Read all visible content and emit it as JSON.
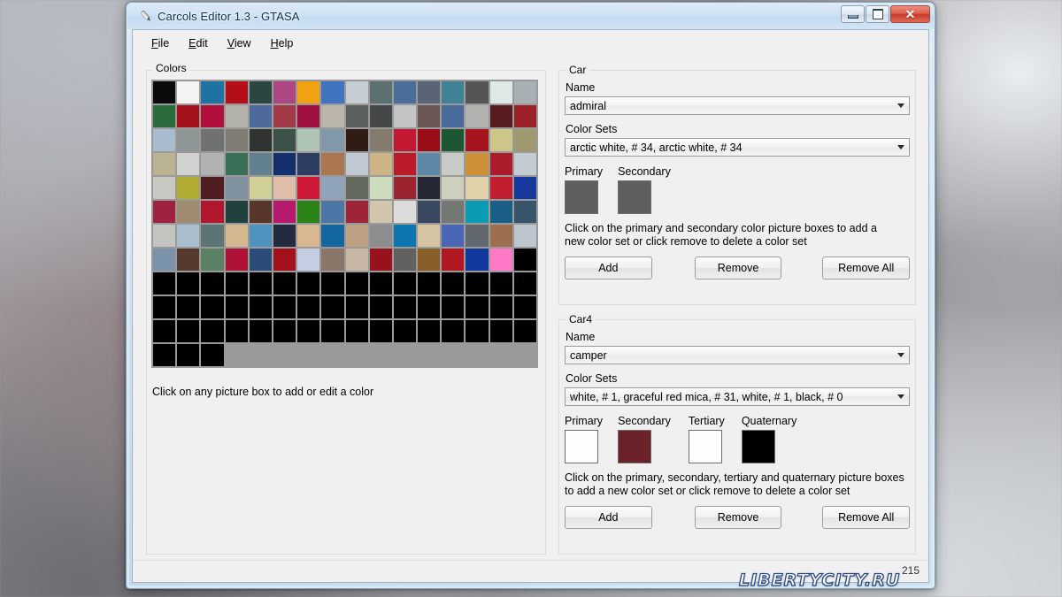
{
  "window": {
    "title": "Carcols Editor 1.3 - GTASA",
    "icon": "pen-icon",
    "buttons": {
      "minimize": "minimize-icon",
      "maximize": "maximize-icon",
      "close": "✕"
    }
  },
  "menu": {
    "items": [
      {
        "label": "File",
        "accel": "F"
      },
      {
        "label": "Edit",
        "accel": "E"
      },
      {
        "label": "View",
        "accel": "V"
      },
      {
        "label": "Help",
        "accel": "H"
      }
    ]
  },
  "colors_panel": {
    "label": "Colors",
    "hint": "Click on any picture box to add or edit a color",
    "columns": 16,
    "swatches": [
      "#0a0a0a",
      "#f3f3f1",
      "#1f72a4",
      "#b50e18",
      "#2b4540",
      "#ab4783",
      "#f0a210",
      "#4073bf",
      "#c7ced3",
      "#5c7070",
      "#4a6d9a",
      "#5a6476",
      "#3f8296",
      "#555555",
      "#dfe7e7",
      "#a9b0b4",
      "#2a6a3c",
      "#a4101c",
      "#b0103b",
      "#b2b2ab",
      "#4d6a9a",
      "#a23a48",
      "#a01141",
      "#bbb6ab",
      "#5c5f5f",
      "#454848",
      "#c4c4c4",
      "#6a5653",
      "#4b6a9c",
      "#b2b2b0",
      "#561c1f",
      "#9c2027",
      "#a7bccf",
      "#8d9695",
      "#707270",
      "#807d74",
      "#2f3432",
      "#3a5247",
      "#b0c4b5",
      "#8198a8",
      "#2e1c15",
      "#857b6d",
      "#c31832",
      "#9a0c18",
      "#1c5632",
      "#a6151e",
      "#cdc689",
      "#a09970",
      "#bab291",
      "#cfd2cf",
      "#b2b2b2",
      "#3a7055",
      "#63808e",
      "#13306e",
      "#2c3d61",
      "#ab7752",
      "#c0c8d2",
      "#cdb487",
      "#bb1a2a",
      "#5e86a8",
      "#c8cbc5",
      "#cd9037",
      "#ad1c2d",
      "#c3ccd2",
      "#c9c9c1",
      "#b0ab31",
      "#501d20",
      "#80929f",
      "#d0cf97",
      "#e0bcab",
      "#cf1736",
      "#8fa4b8",
      "#64695e",
      "#cddcbd",
      "#9c2330",
      "#252735",
      "#cfcfbd",
      "#e0d1a9",
      "#c31d30",
      "#17399e",
      "#9f2241",
      "#9e8a6e",
      "#b1182d",
      "#21413e",
      "#59362c",
      "#b71a6c",
      "#2b8216",
      "#4a77a6",
      "#9e2437",
      "#cfc6ab",
      "#dcdcda",
      "#39485f",
      "#767876",
      "#0b9bb2",
      "#1a5d87",
      "#37546b",
      "#c3c3c0",
      "#a9bfcf",
      "#5d7477",
      "#d3b88f",
      "#4d93bd",
      "#232b3e",
      "#d9b891",
      "#13679e",
      "#c0a082",
      "#8d8d8d",
      "#0d76b0",
      "#d5c3a1",
      "#4a67b7",
      "#61686f",
      "#9e6f4e",
      "#bcc6cf",
      "#7b93aa",
      "#53392e",
      "#5b8164",
      "#b01136",
      "#2c4b77",
      "#a3121a",
      "#c4cfe3",
      "#8a7669",
      "#c9b7a6",
      "#97121d",
      "#616160",
      "#8a5e28",
      "#b31724",
      "#13389e",
      "#ff79c6",
      "#000000"
    ],
    "black_rows": 3,
    "black_partial_row": 3
  },
  "car_section": {
    "label": "Car",
    "name_label": "Name",
    "name_value": "admiral",
    "colorsets_label": "Color Sets",
    "colorsets_value": "arctic white, # 34, arctic white, # 34",
    "swatches": [
      {
        "caption": "Primary",
        "color": "#5e5e5e"
      },
      {
        "caption": "Secondary",
        "color": "#5e5e5e"
      }
    ],
    "hint": "Click on the primary and secondary color picture boxes to add a new color set or click remove to delete a color set",
    "buttons": {
      "add": "Add",
      "remove": "Remove",
      "remove_all": "Remove All"
    }
  },
  "car4_section": {
    "label": "Car4",
    "name_label": "Name",
    "name_value": "camper",
    "colorsets_label": "Color Sets",
    "colorsets_value": "white, # 1, graceful red mica, # 31, white, # 1, black, # 0",
    "swatches": [
      {
        "caption": "Primary",
        "color": "#fdfdfd"
      },
      {
        "caption": "Secondary",
        "color": "#6d2229"
      },
      {
        "caption": "Tertiary",
        "color": "#fdfdfd"
      },
      {
        "caption": "Quaternary",
        "color": "#000000"
      }
    ],
    "hint": "Click on the primary, secondary, tertiary and quaternary picture boxes to add a new color set or click remove to delete a color set",
    "buttons": {
      "add": "Add",
      "remove": "Remove",
      "remove_all": "Remove All"
    }
  },
  "statusbar": {
    "text": "215"
  },
  "watermark": {
    "text": "LIBERTYCITY.RU"
  },
  "colors": {
    "accent": "#1f72a4",
    "close_button": "#c6392a",
    "window_chrome": "#cfe2f4"
  }
}
